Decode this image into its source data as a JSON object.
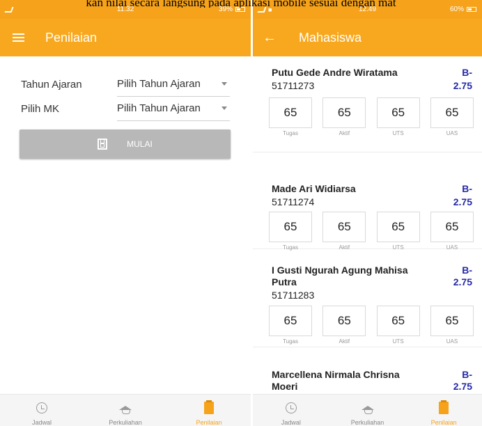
{
  "caption": "kan nilai secara langsung pada aplikasi mobile sesuai dengan mat",
  "left": {
    "status": {
      "time": "11.32",
      "battery": "39%"
    },
    "appbar": {
      "title": "Penilaian"
    },
    "form": {
      "tahun_label": "Tahun Ajaran",
      "tahun_value": "Pilih Tahun Ajaran",
      "mk_label": "Pilih MK",
      "mk_value": "Pilih Tahun Ajaran"
    },
    "start_label": "MULAI",
    "nav": [
      {
        "label": "Jadwal",
        "icon": "alarm-clock-icon"
      },
      {
        "label": "Perkuliahan",
        "icon": "graduation-cap-icon"
      },
      {
        "label": "Penilaian",
        "icon": "notepad-icon",
        "active": true
      }
    ]
  },
  "right": {
    "status": {
      "time": "12.49",
      "battery": "60%"
    },
    "appbar": {
      "title": "Mahasiswa"
    },
    "score_labels": [
      "Tugas",
      "Aktif",
      "UTS",
      "UAS"
    ],
    "students": [
      {
        "name": "Putu Gede Andre Wiratama",
        "nim": "51711273",
        "grade": "B-",
        "gpa": "2.75",
        "scores": [
          "65",
          "65",
          "65",
          "65"
        ]
      },
      {
        "name": "Made Ari Widiarsa",
        "nim": "51711274",
        "grade": "B-",
        "gpa": "2.75",
        "scores": [
          "65",
          "65",
          "65",
          "65"
        ]
      },
      {
        "name": "I Gusti Ngurah Agung Mahisa Putra",
        "nim": "51711283",
        "grade": "B-",
        "gpa": "2.75",
        "scores": [
          "65",
          "65",
          "65",
          "65"
        ]
      },
      {
        "name": "Marcellena Nirmala Chrisna Moeri",
        "nim": "",
        "grade": "B-",
        "gpa": "2.75",
        "scores": []
      }
    ],
    "nav": [
      {
        "label": "Jadwal",
        "icon": "alarm-clock-icon"
      },
      {
        "label": "Perkuliahan",
        "icon": "graduation-cap-icon"
      },
      {
        "label": "Penilaian",
        "icon": "notepad-icon",
        "active": true
      }
    ]
  },
  "colors": {
    "accent": "#f8a81e",
    "grade": "#2429a9",
    "disabled_button": "#b8b8b8"
  }
}
